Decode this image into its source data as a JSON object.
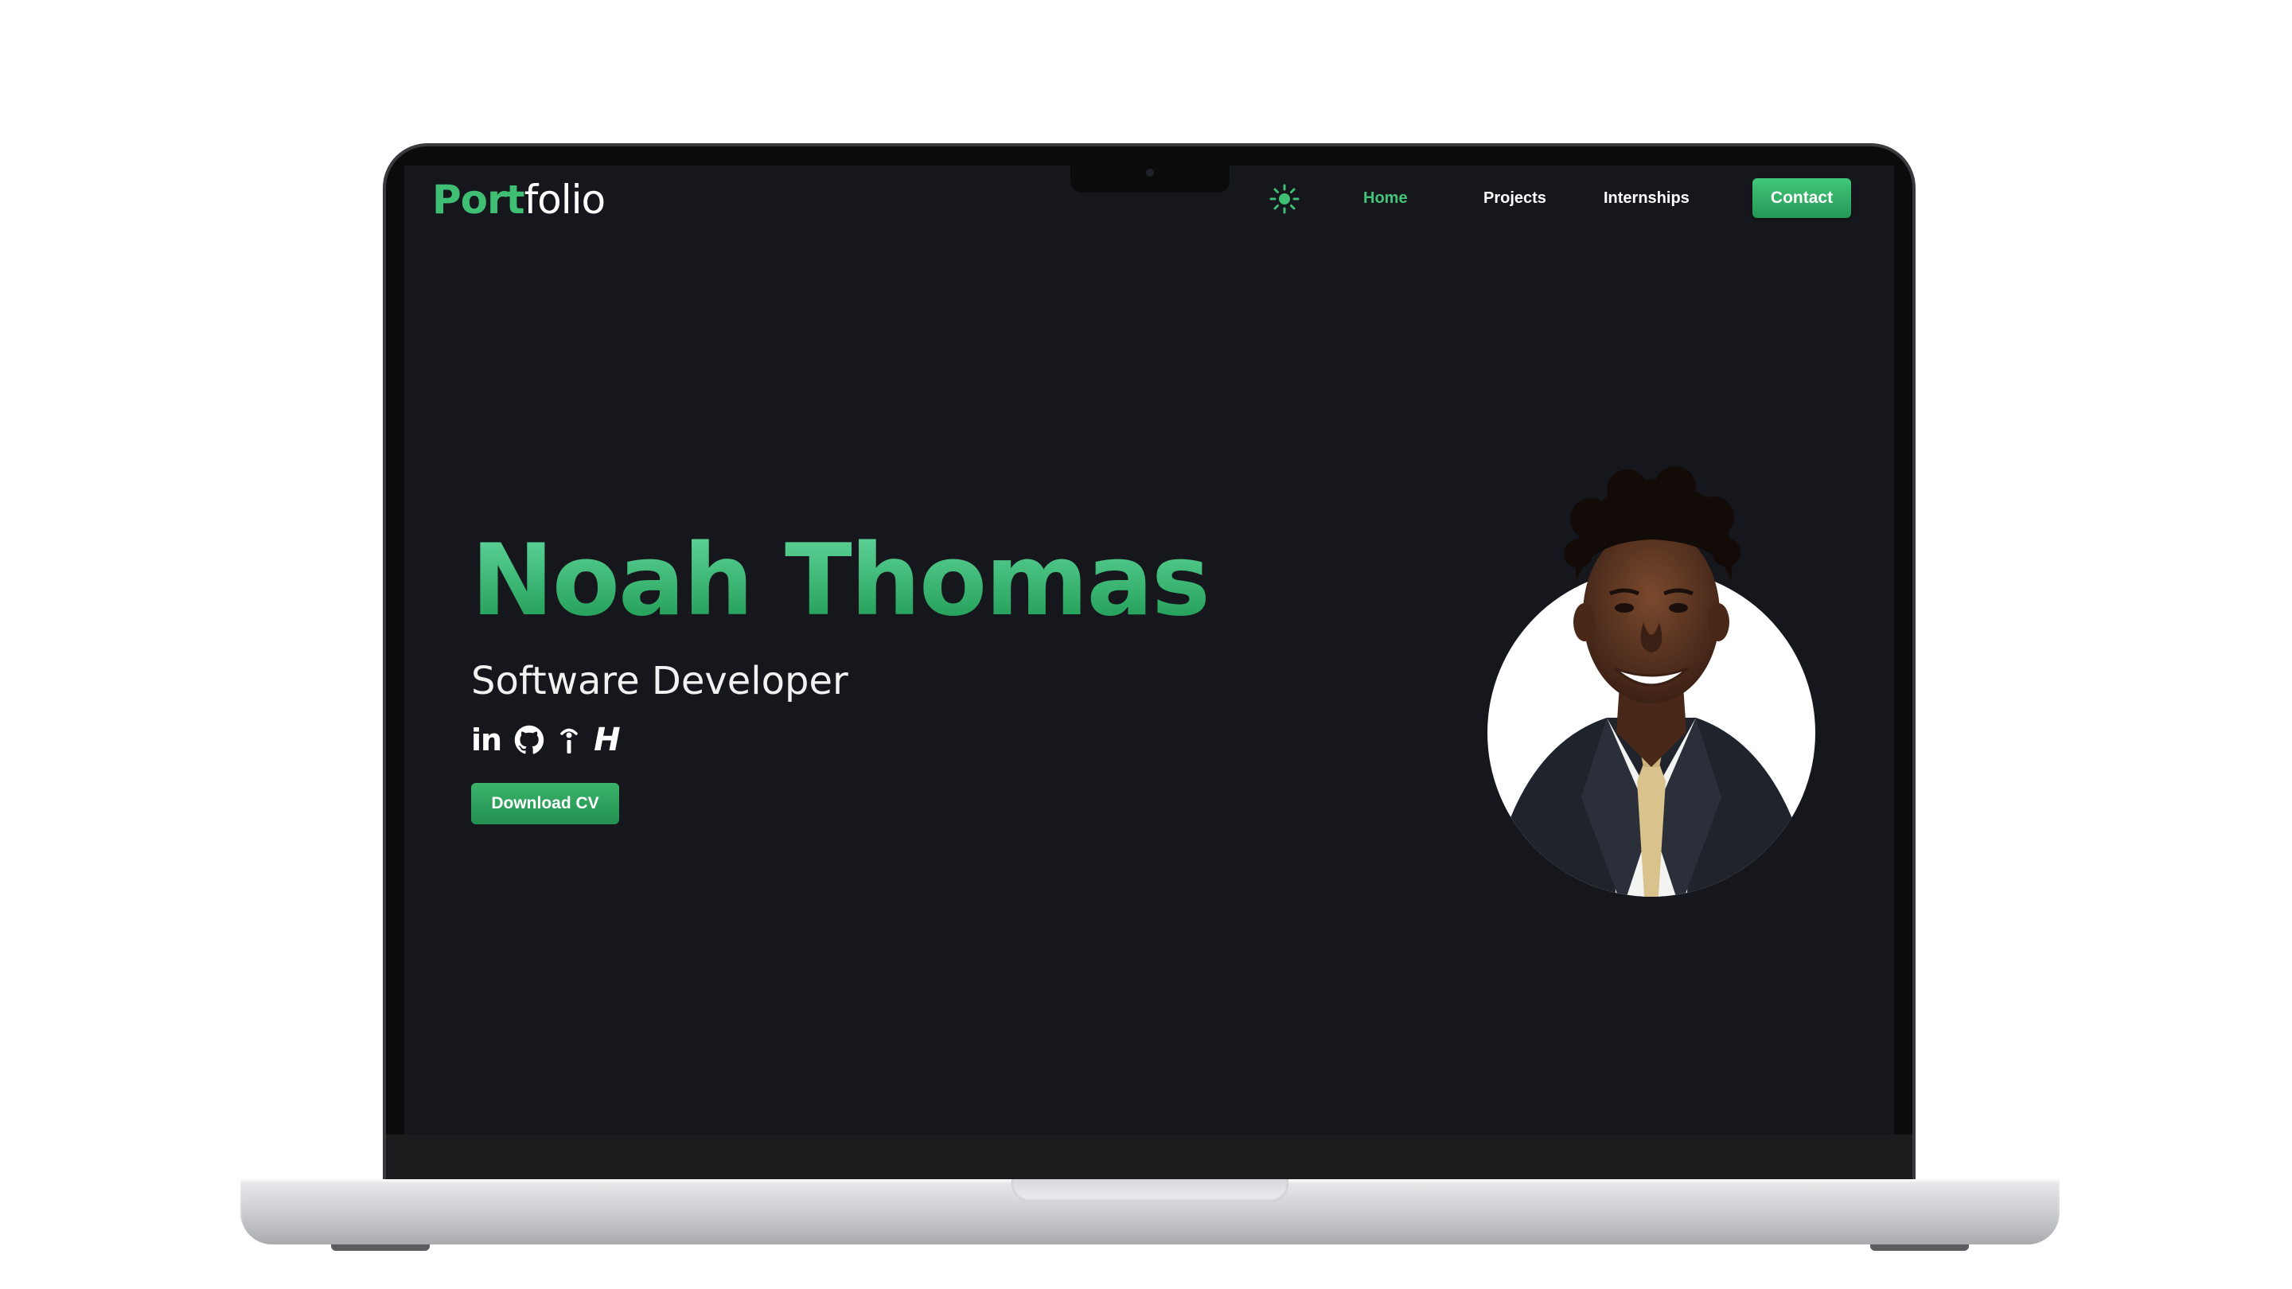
{
  "logo": {
    "accent": "Port",
    "rest": "folio"
  },
  "nav": {
    "theme_icon": "sun-icon",
    "links": [
      "Home",
      "Projects",
      "Internships"
    ],
    "active": "Home",
    "contact": "Contact"
  },
  "hero": {
    "name": "Noah Thomas",
    "role": "Software Developer",
    "download_label": "Download CV",
    "socials": [
      {
        "icon": "linkedin-icon",
        "text": "in"
      },
      {
        "icon": "github-icon"
      },
      {
        "icon": "info-icon"
      },
      {
        "icon": "hashnode-icon",
        "text": "H"
      }
    ],
    "photo": "avatar-photo"
  },
  "colors": {
    "background": "#16171c",
    "accent": "#3fbf73",
    "accent_dark": "#238f50",
    "text": "#ffffff"
  }
}
